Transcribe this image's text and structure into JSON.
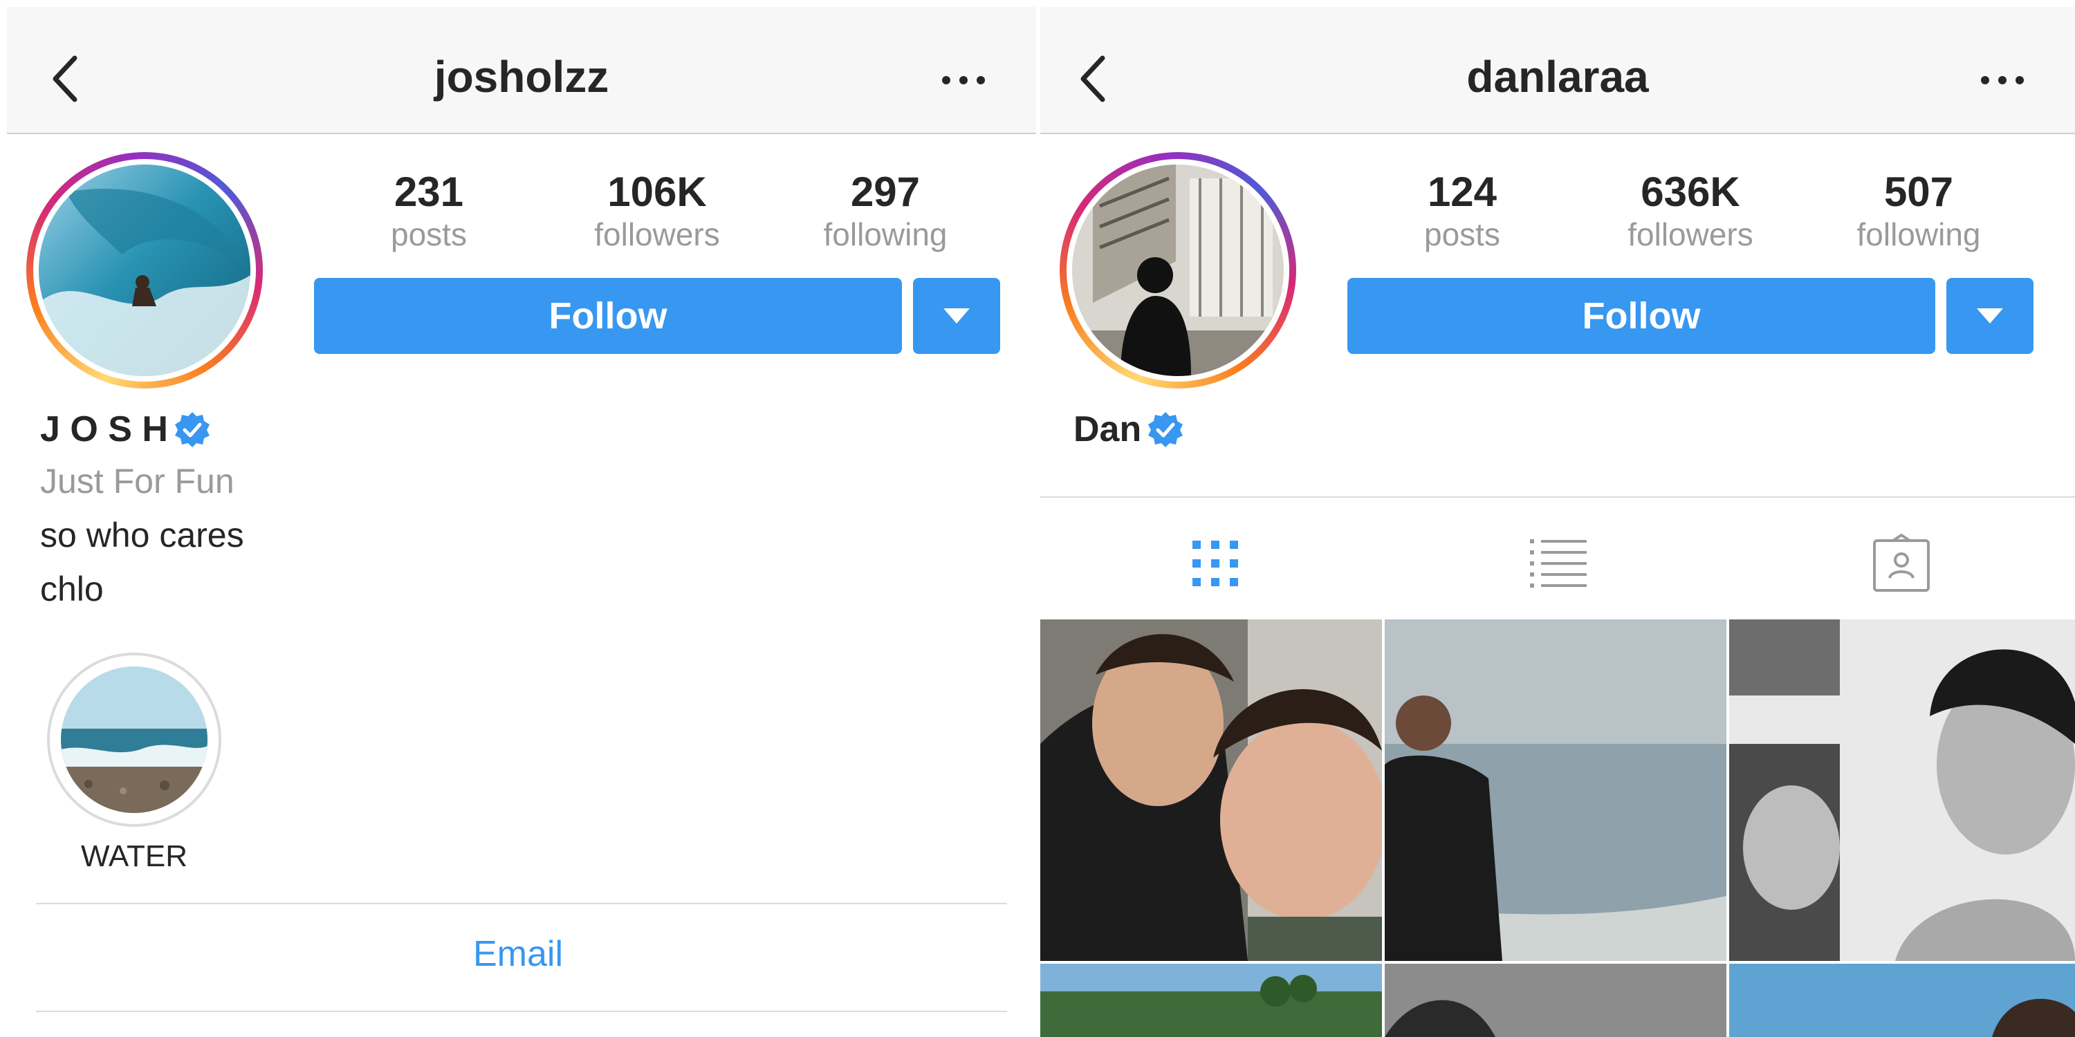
{
  "left_profile": {
    "header": {
      "username": "josholzz"
    },
    "stats": [
      {
        "value": "231",
        "label": "posts"
      },
      {
        "value": "106K",
        "label": "followers"
      },
      {
        "value": "297",
        "label": "following"
      }
    ],
    "follow_label": "Follow",
    "display_name": "J O S H",
    "category": "Just For Fun",
    "bio_lines": [
      "so who cares",
      "chlo"
    ],
    "highlight": {
      "label": "WATER"
    },
    "email_label": "Email"
  },
  "right_profile": {
    "header": {
      "username": "danlaraa"
    },
    "stats": [
      {
        "value": "124",
        "label": "posts"
      },
      {
        "value": "636K",
        "label": "followers"
      },
      {
        "value": "507",
        "label": "following"
      }
    ],
    "follow_label": "Follow",
    "display_name": "Dan",
    "tabs": [
      {
        "icon": "grid-icon",
        "active": true
      },
      {
        "icon": "list-icon",
        "active": false
      },
      {
        "icon": "tagged-icon",
        "active": false
      }
    ]
  },
  "colors": {
    "accent": "#3897f0",
    "text": "#262626",
    "muted": "#9a9a9a",
    "header_bg": "#f7f7f7",
    "divider": "#dbdbdb"
  }
}
